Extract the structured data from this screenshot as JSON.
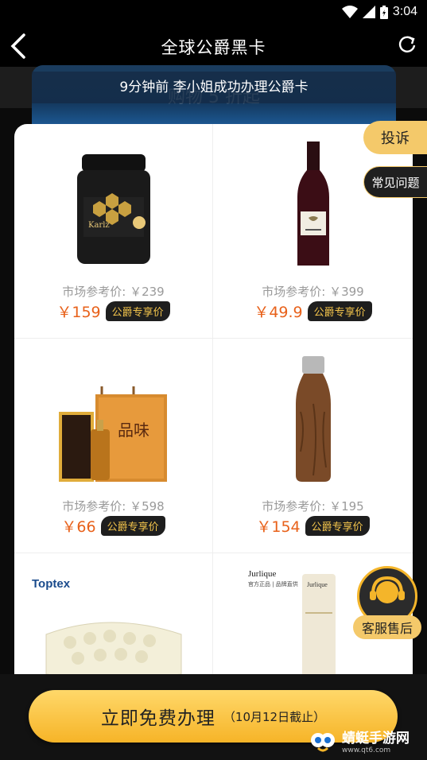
{
  "status_bar": {
    "time": "3:04"
  },
  "header": {
    "title": "全球公爵黑卡"
  },
  "banner": {
    "bg_text": "购物 5 折起",
    "notice": "9分钟前  李小姐成功办理公爵卡"
  },
  "side_buttons": {
    "complaint": "投诉",
    "faq": "常见问题"
  },
  "products": [
    {
      "market_price": "市场参考价: ￥239",
      "price": "￥159",
      "tag": "公爵专享价",
      "image": "honey-jar"
    },
    {
      "market_price": "市场参考价: ￥399",
      "price": "￥49.9",
      "tag": "公爵专享价",
      "image": "wine-bottle"
    },
    {
      "market_price": "市场参考价: ￥598",
      "price": "￥66",
      "tag": "公爵专享价",
      "image": "liquor-gift-box"
    },
    {
      "market_price": "市场参考价: ￥195",
      "price": "￥154",
      "tag": "公爵专享价",
      "image": "wooden-thermos"
    },
    {
      "brand": "Toptex",
      "image": "latex-pillow"
    },
    {
      "brand": "Jurlique",
      "brand_sub": "官方正品 | 品牌直供",
      "image": "cream-tube"
    }
  ],
  "customer_service": {
    "label": "客服售后"
  },
  "cta": {
    "main": "立即免费办理",
    "sub": "（10月12日截止）"
  },
  "watermark": {
    "text": "蜻蜓手游网",
    "sub": "www.qt6.com"
  }
}
